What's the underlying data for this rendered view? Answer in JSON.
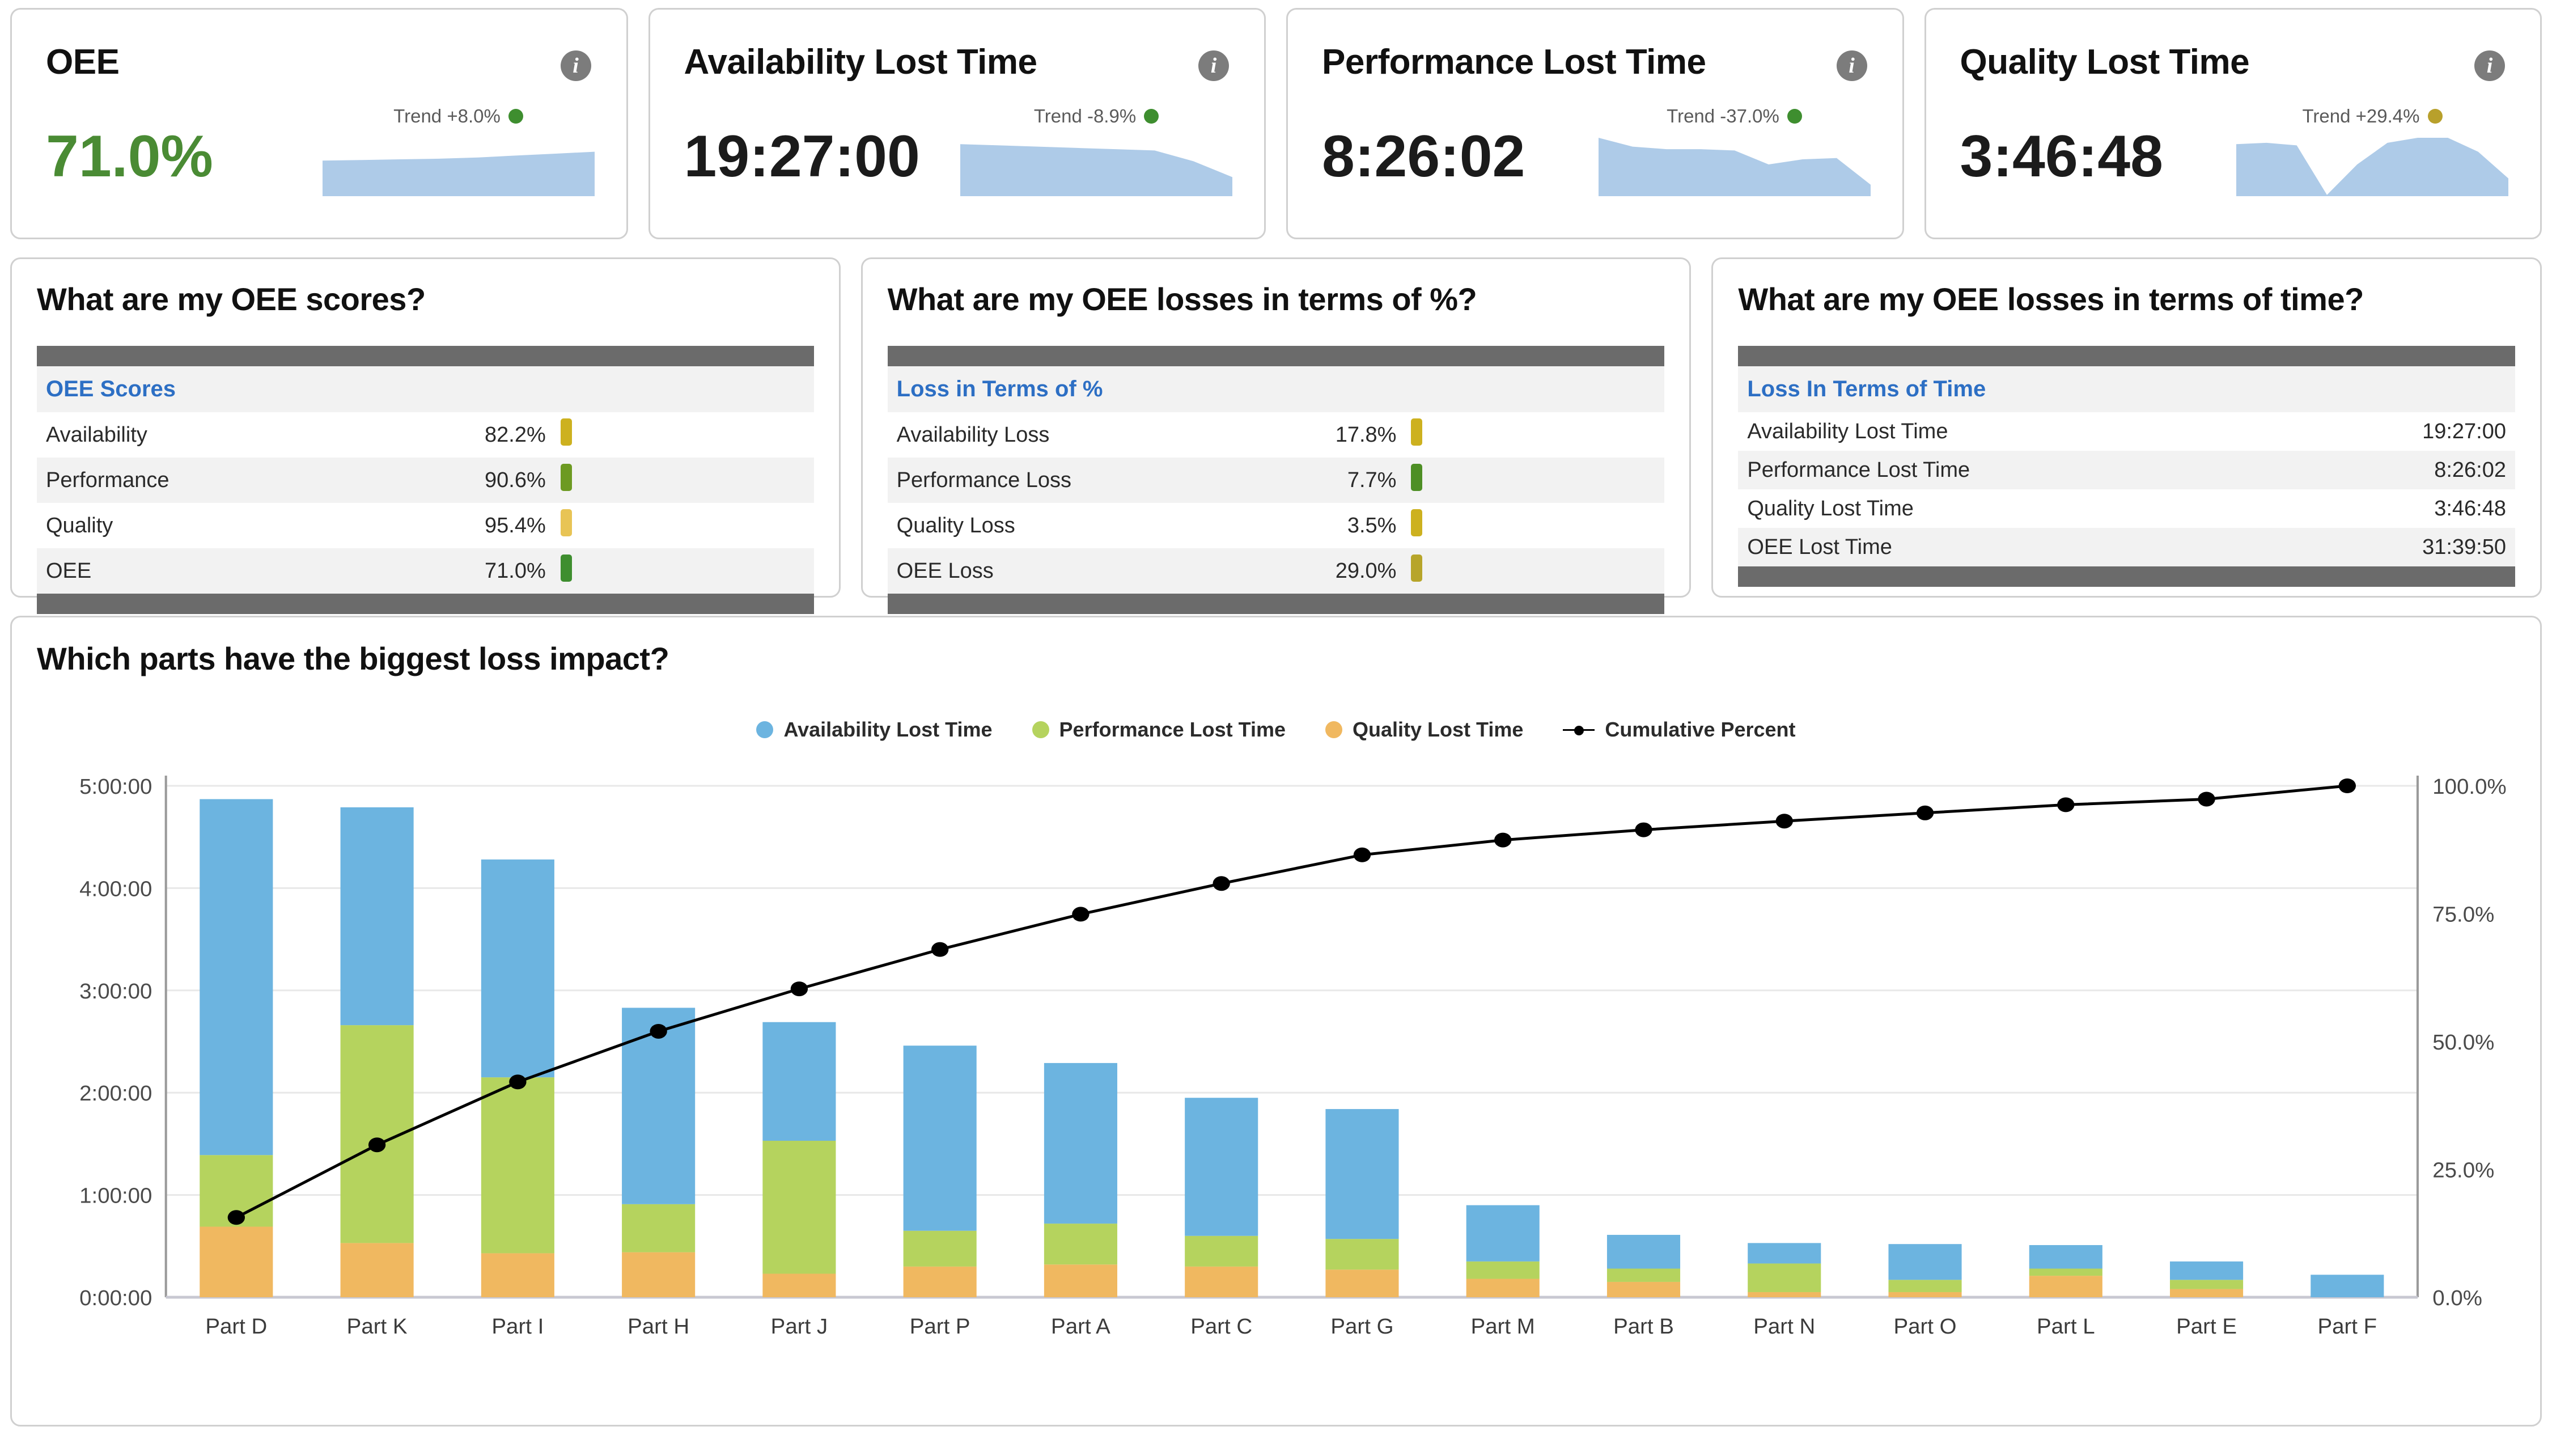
{
  "kpis": [
    {
      "title": "OEE",
      "value": "71.0%",
      "value_color": "green",
      "trend_label": "Trend +8.0%",
      "trend_dot_color": "#3e8e2f",
      "info_icon": "info-icon",
      "spark": [
        0.56,
        0.57,
        0.58,
        0.59,
        0.61,
        0.64,
        0.67,
        0.7
      ]
    },
    {
      "title": "Availability Lost Time",
      "value": "19:27:00",
      "value_color": "dark",
      "trend_label": "Trend -8.9%",
      "trend_dot_color": "#3e8e2f",
      "info_icon": "info-icon",
      "spark": [
        0.82,
        0.8,
        0.78,
        0.76,
        0.74,
        0.72,
        0.55,
        0.3
      ]
    },
    {
      "title": "Performance Lost Time",
      "value": "8:26:02",
      "value_color": "dark",
      "trend_label": "Trend -37.0%",
      "trend_dot_color": "#3e8e2f",
      "info_icon": "info-icon",
      "spark": [
        0.92,
        0.78,
        0.74,
        0.74,
        0.72,
        0.5,
        0.58,
        0.6,
        0.18
      ]
    },
    {
      "title": "Quality Lost Time",
      "value": "3:46:48",
      "value_color": "dark",
      "trend_label": "Trend +29.4%",
      "trend_dot_color": "#b8a02b",
      "info_icon": "info-icon",
      "spark": [
        0.82,
        0.84,
        0.8,
        0.02,
        0.5,
        0.84,
        0.92,
        0.92,
        0.7,
        0.28
      ]
    }
  ],
  "panels": [
    {
      "title": "What are my OEE scores?",
      "header": "OEE Scores",
      "has_indicator": true,
      "rows": [
        {
          "label": "Availability",
          "value": "82.2%",
          "color": "#cdb11f"
        },
        {
          "label": "Performance",
          "value": "90.6%",
          "color": "#6d9a22"
        },
        {
          "label": "Quality",
          "value": "95.4%",
          "color": "#e8c455"
        },
        {
          "label": "OEE",
          "value": "71.0%",
          "color": "#3e8e2f"
        }
      ]
    },
    {
      "title": "What are my OEE losses in terms of %?",
      "header": "Loss in Terms of %",
      "has_indicator": true,
      "rows": [
        {
          "label": "Availability Loss",
          "value": "17.8%",
          "color": "#cdb11f"
        },
        {
          "label": "Performance Loss",
          "value": "7.7%",
          "color": "#4e8f25"
        },
        {
          "label": "Quality Loss",
          "value": "3.5%",
          "color": "#cdb11f"
        },
        {
          "label": "OEE Loss",
          "value": "29.0%",
          "color": "#b7a52a"
        }
      ]
    },
    {
      "title": "What are my OEE losses in terms of time?",
      "header": "Loss In Terms of Time",
      "has_indicator": false,
      "rows": [
        {
          "label": "Availability Lost Time",
          "value": "19:27:00"
        },
        {
          "label": "Performance Lost Time",
          "value": "8:26:02"
        },
        {
          "label": "Quality Lost Time",
          "value": "3:46:48"
        },
        {
          "label": "OEE Lost Time",
          "value": "31:39:50"
        }
      ]
    }
  ],
  "pareto": {
    "title": "Which parts have the biggest loss impact?",
    "legend": [
      {
        "label": "Availability Lost Time",
        "color": "#6cb4e0",
        "marker": "dot"
      },
      {
        "label": "Performance Lost Time",
        "color": "#b5d35e",
        "marker": "dot"
      },
      {
        "label": "Quality Lost Time",
        "color": "#f0b860",
        "marker": "dot"
      },
      {
        "label": "Cumulative Percent",
        "color": "#000000",
        "marker": "line"
      }
    ]
  },
  "chart_data": {
    "type": "bar",
    "title": "Which parts have the biggest loss impact?",
    "xlabel": "",
    "ylabel": "",
    "y_unit": "hours",
    "grid": true,
    "legend_position": "top-center",
    "categories": [
      "Part D",
      "Part K",
      "Part I",
      "Part H",
      "Part J",
      "Part P",
      "Part A",
      "Part C",
      "Part G",
      "Part M",
      "Part B",
      "Part N",
      "Part O",
      "Part L",
      "Part E",
      "Part F"
    ],
    "y_left_ticks": [
      "0:00:00",
      "1:00:00",
      "2:00:00",
      "3:00:00",
      "4:00:00",
      "5:00:00"
    ],
    "y_left_ylim": [
      0,
      5.0
    ],
    "y_right_ticks": [
      "0.0%",
      "25.0%",
      "50.0%",
      "75.0%",
      "100.0%"
    ],
    "y_right_ylim": [
      0,
      100
    ],
    "series": [
      {
        "name": "Quality Lost Time",
        "color": "#f0b860",
        "values": [
          0.69,
          0.53,
          0.43,
          0.44,
          0.23,
          0.3,
          0.32,
          0.3,
          0.27,
          0.18,
          0.15,
          0.05,
          0.05,
          0.21,
          0.08,
          0.0
        ]
      },
      {
        "name": "Performance Lost Time",
        "color": "#b5d35e",
        "values": [
          0.7,
          2.13,
          1.72,
          0.47,
          1.3,
          0.35,
          0.4,
          0.3,
          0.3,
          0.17,
          0.13,
          0.28,
          0.12,
          0.07,
          0.09,
          0.0
        ]
      },
      {
        "name": "Availability Lost Time",
        "color": "#6cb4e0",
        "values": [
          3.48,
          2.13,
          2.13,
          1.92,
          1.16,
          1.81,
          1.57,
          1.35,
          1.27,
          0.55,
          0.33,
          0.2,
          0.35,
          0.23,
          0.18,
          0.22
        ]
      }
    ],
    "cumulative_name": "Cumulative Percent",
    "cumulative_color": "#000000",
    "cumulative_values": [
      15.6,
      29.8,
      42.1,
      52.0,
      60.3,
      68.0,
      74.9,
      80.9,
      86.5,
      89.4,
      91.4,
      93.1,
      94.7,
      96.3,
      97.4,
      100.0
    ]
  }
}
